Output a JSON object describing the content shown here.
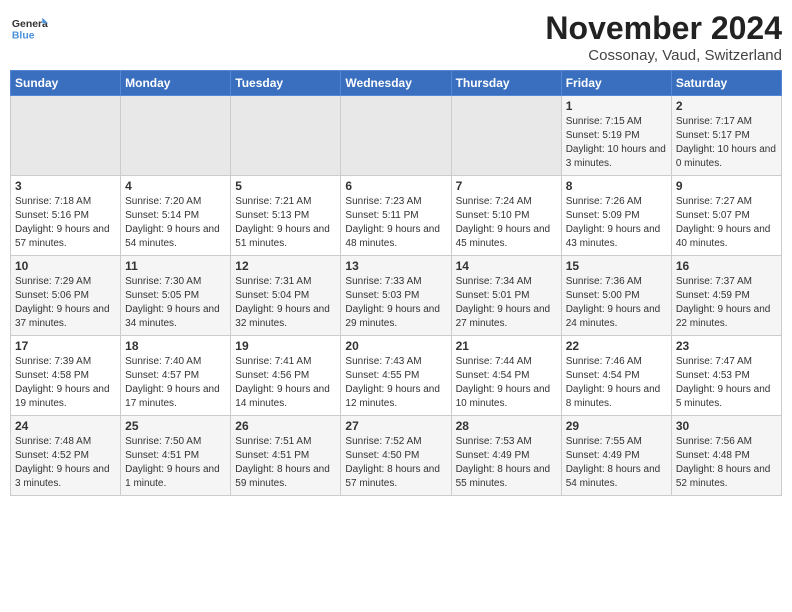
{
  "logo": {
    "line1": "General",
    "line2": "Blue"
  },
  "title": "November 2024",
  "subtitle": "Cossonay, Vaud, Switzerland",
  "weekdays": [
    "Sunday",
    "Monday",
    "Tuesday",
    "Wednesday",
    "Thursday",
    "Friday",
    "Saturday"
  ],
  "weeks": [
    [
      {
        "day": "",
        "info": ""
      },
      {
        "day": "",
        "info": ""
      },
      {
        "day": "",
        "info": ""
      },
      {
        "day": "",
        "info": ""
      },
      {
        "day": "",
        "info": ""
      },
      {
        "day": "1",
        "info": "Sunrise: 7:15 AM\nSunset: 5:19 PM\nDaylight: 10 hours and 3 minutes."
      },
      {
        "day": "2",
        "info": "Sunrise: 7:17 AM\nSunset: 5:17 PM\nDaylight: 10 hours and 0 minutes."
      }
    ],
    [
      {
        "day": "3",
        "info": "Sunrise: 7:18 AM\nSunset: 5:16 PM\nDaylight: 9 hours and 57 minutes."
      },
      {
        "day": "4",
        "info": "Sunrise: 7:20 AM\nSunset: 5:14 PM\nDaylight: 9 hours and 54 minutes."
      },
      {
        "day": "5",
        "info": "Sunrise: 7:21 AM\nSunset: 5:13 PM\nDaylight: 9 hours and 51 minutes."
      },
      {
        "day": "6",
        "info": "Sunrise: 7:23 AM\nSunset: 5:11 PM\nDaylight: 9 hours and 48 minutes."
      },
      {
        "day": "7",
        "info": "Sunrise: 7:24 AM\nSunset: 5:10 PM\nDaylight: 9 hours and 45 minutes."
      },
      {
        "day": "8",
        "info": "Sunrise: 7:26 AM\nSunset: 5:09 PM\nDaylight: 9 hours and 43 minutes."
      },
      {
        "day": "9",
        "info": "Sunrise: 7:27 AM\nSunset: 5:07 PM\nDaylight: 9 hours and 40 minutes."
      }
    ],
    [
      {
        "day": "10",
        "info": "Sunrise: 7:29 AM\nSunset: 5:06 PM\nDaylight: 9 hours and 37 minutes."
      },
      {
        "day": "11",
        "info": "Sunrise: 7:30 AM\nSunset: 5:05 PM\nDaylight: 9 hours and 34 minutes."
      },
      {
        "day": "12",
        "info": "Sunrise: 7:31 AM\nSunset: 5:04 PM\nDaylight: 9 hours and 32 minutes."
      },
      {
        "day": "13",
        "info": "Sunrise: 7:33 AM\nSunset: 5:03 PM\nDaylight: 9 hours and 29 minutes."
      },
      {
        "day": "14",
        "info": "Sunrise: 7:34 AM\nSunset: 5:01 PM\nDaylight: 9 hours and 27 minutes."
      },
      {
        "day": "15",
        "info": "Sunrise: 7:36 AM\nSunset: 5:00 PM\nDaylight: 9 hours and 24 minutes."
      },
      {
        "day": "16",
        "info": "Sunrise: 7:37 AM\nSunset: 4:59 PM\nDaylight: 9 hours and 22 minutes."
      }
    ],
    [
      {
        "day": "17",
        "info": "Sunrise: 7:39 AM\nSunset: 4:58 PM\nDaylight: 9 hours and 19 minutes."
      },
      {
        "day": "18",
        "info": "Sunrise: 7:40 AM\nSunset: 4:57 PM\nDaylight: 9 hours and 17 minutes."
      },
      {
        "day": "19",
        "info": "Sunrise: 7:41 AM\nSunset: 4:56 PM\nDaylight: 9 hours and 14 minutes."
      },
      {
        "day": "20",
        "info": "Sunrise: 7:43 AM\nSunset: 4:55 PM\nDaylight: 9 hours and 12 minutes."
      },
      {
        "day": "21",
        "info": "Sunrise: 7:44 AM\nSunset: 4:54 PM\nDaylight: 9 hours and 10 minutes."
      },
      {
        "day": "22",
        "info": "Sunrise: 7:46 AM\nSunset: 4:54 PM\nDaylight: 9 hours and 8 minutes."
      },
      {
        "day": "23",
        "info": "Sunrise: 7:47 AM\nSunset: 4:53 PM\nDaylight: 9 hours and 5 minutes."
      }
    ],
    [
      {
        "day": "24",
        "info": "Sunrise: 7:48 AM\nSunset: 4:52 PM\nDaylight: 9 hours and 3 minutes."
      },
      {
        "day": "25",
        "info": "Sunrise: 7:50 AM\nSunset: 4:51 PM\nDaylight: 9 hours and 1 minute."
      },
      {
        "day": "26",
        "info": "Sunrise: 7:51 AM\nSunset: 4:51 PM\nDaylight: 8 hours and 59 minutes."
      },
      {
        "day": "27",
        "info": "Sunrise: 7:52 AM\nSunset: 4:50 PM\nDaylight: 8 hours and 57 minutes."
      },
      {
        "day": "28",
        "info": "Sunrise: 7:53 AM\nSunset: 4:49 PM\nDaylight: 8 hours and 55 minutes."
      },
      {
        "day": "29",
        "info": "Sunrise: 7:55 AM\nSunset: 4:49 PM\nDaylight: 8 hours and 54 minutes."
      },
      {
        "day": "30",
        "info": "Sunrise: 7:56 AM\nSunset: 4:48 PM\nDaylight: 8 hours and 52 minutes."
      }
    ]
  ]
}
